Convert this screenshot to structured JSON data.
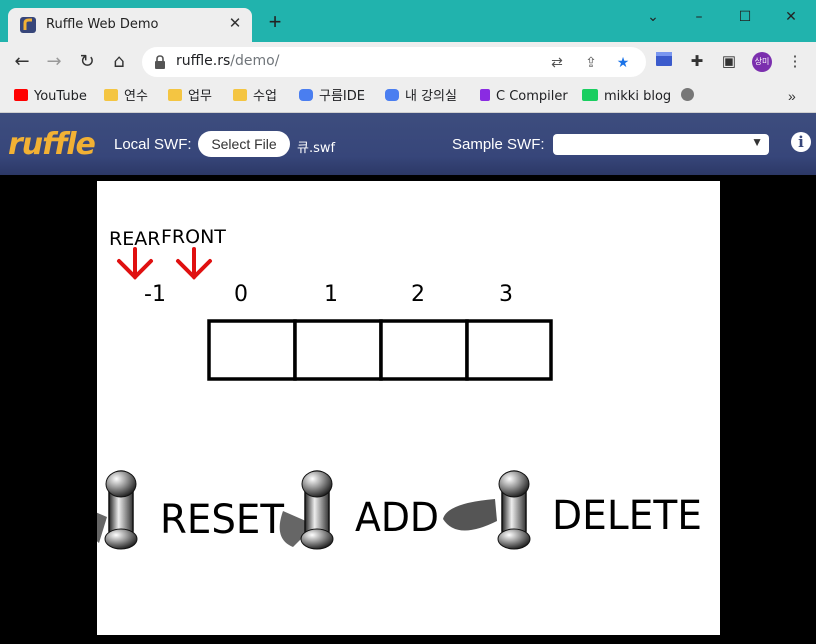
{
  "browser": {
    "tab_title": "Ruffle Web Demo",
    "tab_close": "✕",
    "new_tab": "+",
    "window_controls": {
      "minimize": "⌄",
      "restore": "–",
      "maximize": "☐",
      "close": "✕"
    },
    "url_host": "ruffle.rs",
    "url_path": "/demo/",
    "profile_label": "상미"
  },
  "bookmarks": [
    {
      "label": "YouTube",
      "icon": "youtube-icon",
      "color": "#ff0000"
    },
    {
      "label": "연수",
      "icon": "folder-icon",
      "color": "#f4c542"
    },
    {
      "label": "업무",
      "icon": "folder-icon",
      "color": "#f4c542"
    },
    {
      "label": "수업",
      "icon": "folder-icon",
      "color": "#f4c542"
    },
    {
      "label": "구름IDE",
      "icon": "goorm-icon",
      "color": "#4a7ef0"
    },
    {
      "label": "내 강의실",
      "icon": "goorm-icon",
      "color": "#4a7ef0"
    },
    {
      "label": "C Compiler",
      "icon": "compiler-icon",
      "color": "#8a2be2"
    },
    {
      "label": "mikki blog",
      "icon": "naver-blog-icon",
      "color": "#19ce60"
    }
  ],
  "ruffle": {
    "logo": "ruffle",
    "local_swf_label": "Local SWF:",
    "select_file_label": "Select File",
    "file_name": "큐.swf",
    "sample_swf_label": "Sample SWF:",
    "sample_selected": "",
    "info": "i"
  },
  "stage": {
    "rear_label": "REAR",
    "front_label": "FRONT",
    "indices": [
      "-1",
      "0",
      "1",
      "2",
      "3"
    ],
    "queue_cells": [
      "",
      "",
      "",
      ""
    ],
    "buttons": {
      "reset": "RESET",
      "add": "ADD",
      "delete": "DELETE"
    },
    "arrow_color": "#e01010"
  }
}
